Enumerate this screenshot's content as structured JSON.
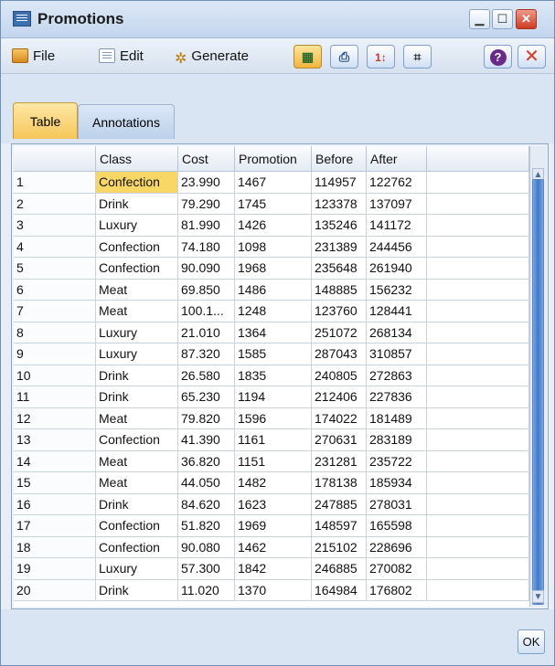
{
  "window": {
    "title": "Promotions"
  },
  "menu": {
    "file": "File",
    "edit": "Edit",
    "generate": "Generate"
  },
  "toolbar": {
    "buttons": [
      "table-view",
      "print",
      "sort",
      "binoculars",
      "help",
      "close"
    ]
  },
  "tabs": [
    {
      "label": "Table",
      "active": true
    },
    {
      "label": "Annotations",
      "active": false
    }
  ],
  "table": {
    "columns": [
      "",
      "Class",
      "Cost",
      "Promotion",
      "Before",
      "After"
    ],
    "rows": [
      [
        "1",
        "Confection",
        "23.990",
        "1467",
        "114957",
        "122762"
      ],
      [
        "2",
        "Drink",
        "79.290",
        "1745",
        "123378",
        "137097"
      ],
      [
        "3",
        "Luxury",
        "81.990",
        "1426",
        "135246",
        "141172"
      ],
      [
        "4",
        "Confection",
        "74.180",
        "1098",
        "231389",
        "244456"
      ],
      [
        "5",
        "Confection",
        "90.090",
        "1968",
        "235648",
        "261940"
      ],
      [
        "6",
        "Meat",
        "69.850",
        "1486",
        "148885",
        "156232"
      ],
      [
        "7",
        "Meat",
        "100.1...",
        "1248",
        "123760",
        "128441"
      ],
      [
        "8",
        "Luxury",
        "21.010",
        "1364",
        "251072",
        "268134"
      ],
      [
        "9",
        "Luxury",
        "87.320",
        "1585",
        "287043",
        "310857"
      ],
      [
        "10",
        "Drink",
        "26.580",
        "1835",
        "240805",
        "272863"
      ],
      [
        "11",
        "Drink",
        "65.230",
        "1194",
        "212406",
        "227836"
      ],
      [
        "12",
        "Meat",
        "79.820",
        "1596",
        "174022",
        "181489"
      ],
      [
        "13",
        "Confection",
        "41.390",
        "1161",
        "270631",
        "283189"
      ],
      [
        "14",
        "Meat",
        "36.820",
        "1151",
        "231281",
        "235722"
      ],
      [
        "15",
        "Meat",
        "44.050",
        "1482",
        "178138",
        "185934"
      ],
      [
        "16",
        "Drink",
        "84.620",
        "1623",
        "247885",
        "278031"
      ],
      [
        "17",
        "Confection",
        "51.820",
        "1969",
        "148597",
        "165598"
      ],
      [
        "18",
        "Confection",
        "90.080",
        "1462",
        "215102",
        "228696"
      ],
      [
        "19",
        "Luxury",
        "57.300",
        "1842",
        "246885",
        "270082"
      ],
      [
        "20",
        "Drink",
        "11.020",
        "1370",
        "164984",
        "176802"
      ]
    ],
    "selected_cell": {
      "row": 0,
      "column": "Class"
    }
  },
  "footer": {
    "ok_label": "OK"
  },
  "colors": {
    "selection": "#f9d766",
    "active_tab": "#f6c659",
    "scroll_thumb": "#3f78c8"
  }
}
